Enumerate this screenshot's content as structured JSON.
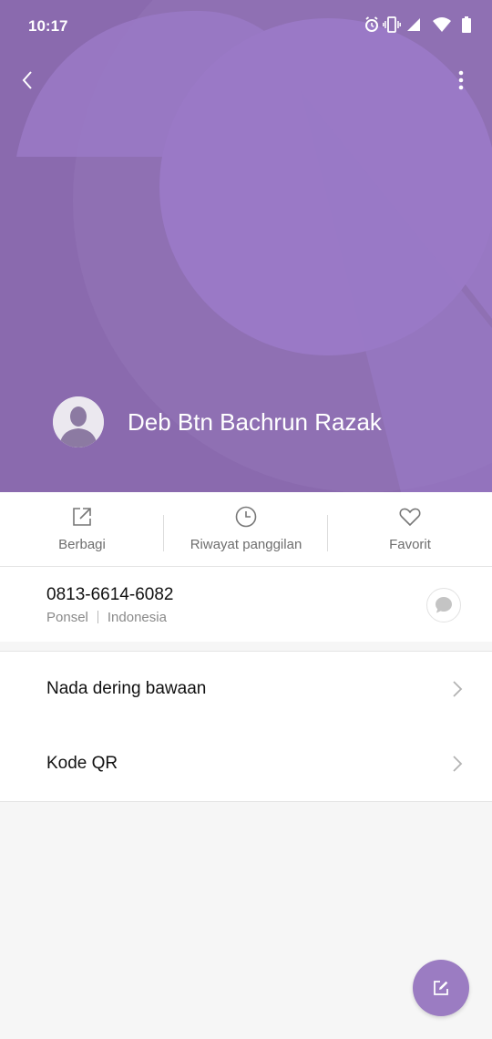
{
  "status_bar": {
    "time": "10:17",
    "icons": [
      "alarm-icon",
      "vibrate-icon",
      "cell-signal-icon",
      "wifi-icon",
      "battery-icon"
    ]
  },
  "top_bar": {
    "back_icon": "chevron-left-icon",
    "more_icon": "more-vertical-icon"
  },
  "contact": {
    "name": "Deb Btn Bachrun Razak",
    "avatar_icon": "person-silhouette-icon"
  },
  "actions": [
    {
      "label": "Berbagi",
      "icon": "share-icon"
    },
    {
      "label": "Riwayat panggilan",
      "icon": "clock-icon"
    },
    {
      "label": "Favorit",
      "icon": "heart-icon"
    }
  ],
  "phone": {
    "number": "0813-6614-6082",
    "type": "Ponsel",
    "region": "Indonesia",
    "message_icon": "message-bubble-icon"
  },
  "settings": [
    {
      "label": "Nada dering bawaan"
    },
    {
      "label": "Kode QR"
    }
  ],
  "fab": {
    "icon": "edit-icon"
  },
  "colors": {
    "header": "#8a6aae",
    "header_shape": "#9a79c6",
    "fab": "#9b7cc2"
  }
}
